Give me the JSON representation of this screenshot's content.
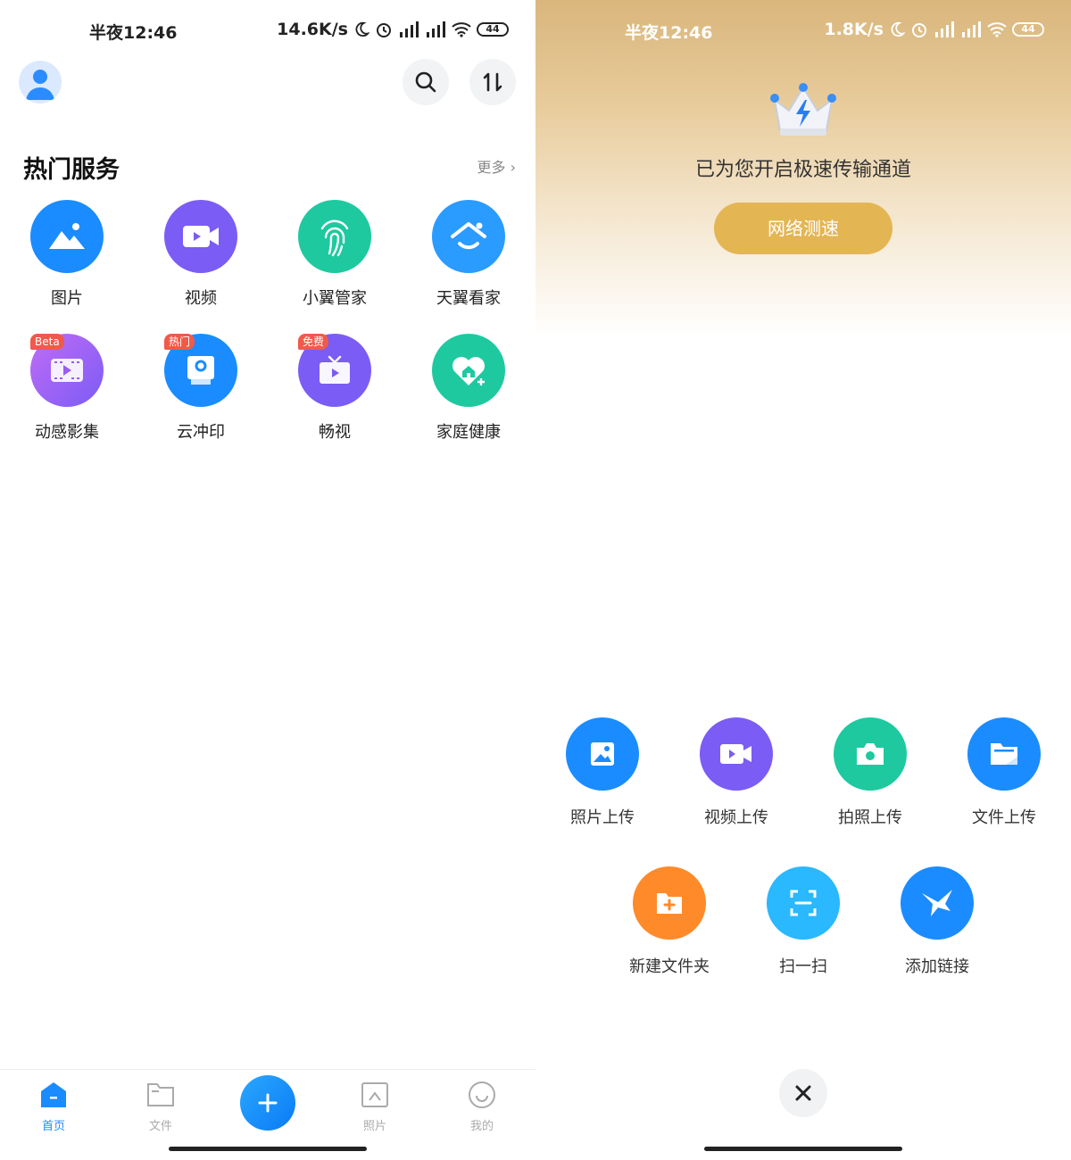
{
  "left_screen": {
    "status_bar": {
      "time": "半夜12:46",
      "net_speed": "14.6K/s",
      "battery": "44"
    },
    "header": {
      "avatar_icon": "user-avatar-icon",
      "search_icon": "search-icon",
      "transfer_icon": "transfer-icon"
    },
    "hot_services": {
      "title": "热门服务",
      "more_label": "更多 ›",
      "items": [
        {
          "label": "图片",
          "icon": "image-icon",
          "color": "#1a8cff"
        },
        {
          "label": "视频",
          "icon": "video-icon",
          "color": "#7b5cf5"
        },
        {
          "label": "小翼管家",
          "icon": "fingerprint-icon",
          "color": "#1ec9a0"
        },
        {
          "label": "天翼看家",
          "icon": "home-watch-icon",
          "color": "#2a9bff"
        },
        {
          "label": "动感影集",
          "icon": "film-icon",
          "color": "#9a5cf0",
          "tag": "Beta"
        },
        {
          "label": "云冲印",
          "icon": "print-icon",
          "color": "#1a8cff",
          "tag": "热门"
        },
        {
          "label": "畅视",
          "icon": "tv-icon",
          "color": "#7b5cf5",
          "tag": "免费"
        },
        {
          "label": "家庭健康",
          "icon": "heart-house-icon",
          "color": "#1ec9a0"
        }
      ]
    },
    "tabbar": {
      "tabs": [
        {
          "label": "首页",
          "icon": "home-icon",
          "active": true
        },
        {
          "label": "文件",
          "icon": "folder-icon",
          "active": false
        },
        {
          "label": "照片",
          "icon": "photo-icon",
          "active": false
        },
        {
          "label": "我的",
          "icon": "smile-icon",
          "active": false
        }
      ],
      "plus_icon": "plus-icon"
    }
  },
  "right_screen": {
    "status_bar": {
      "time": "半夜12:46",
      "net_speed": "1.8K/s",
      "battery": "44"
    },
    "banner": {
      "icon": "crown-icon",
      "text": "已为您开启极速传输通道",
      "button_label": "网络测速"
    },
    "actions_row1": [
      {
        "label": "照片上传",
        "icon": "photo-upload-icon",
        "color": "#1a8cff"
      },
      {
        "label": "视频上传",
        "icon": "video-upload-icon",
        "color": "#7b5cf5"
      },
      {
        "label": "拍照上传",
        "icon": "camera-icon",
        "color": "#1ec9a0"
      },
      {
        "label": "文件上传",
        "icon": "file-upload-icon",
        "color": "#1a8cff"
      }
    ],
    "actions_row2": [
      {
        "label": "新建文件夹",
        "icon": "new-folder-icon",
        "color": "#ff8a2a"
      },
      {
        "label": "扫一扫",
        "icon": "scan-icon",
        "color": "#2ab8ff"
      },
      {
        "label": "添加链接",
        "icon": "bird-link-icon",
        "color": "#1a8cff"
      }
    ],
    "close_icon": "close-icon"
  }
}
